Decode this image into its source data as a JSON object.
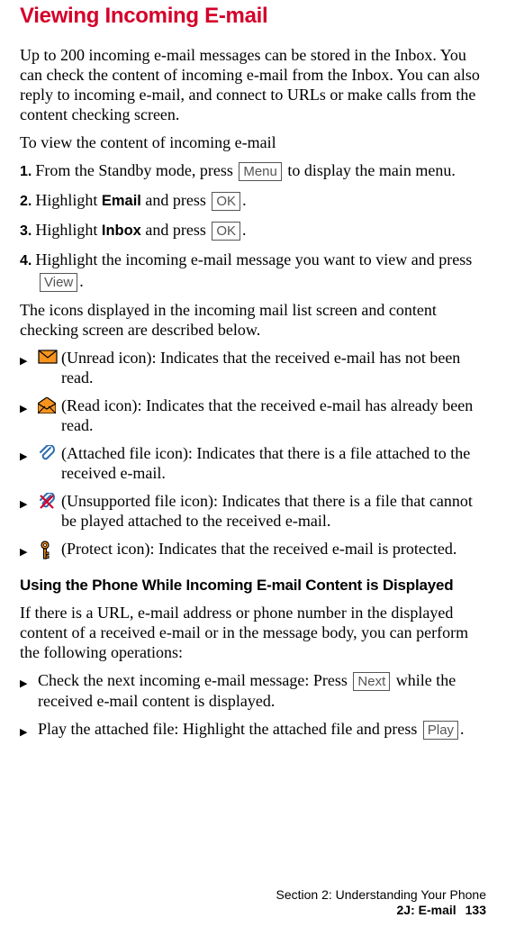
{
  "title": "Viewing Incoming E-mail",
  "intro": "Up to 200 incoming e-mail messages can be stored in the Inbox. You can check the content of incoming e-mail from the Inbox. You can also reply to incoming e-mail, and connect to URLs or make calls from the content checking screen.",
  "lead": "To view the content of incoming e-mail",
  "steps": {
    "s1": {
      "num": "1.",
      "a": "From the Standby mode, press ",
      "key": "Menu",
      "b": " to display the main menu."
    },
    "s2": {
      "num": "2.",
      "a": "Highlight ",
      "strong": "Email",
      "b": " and press ",
      "key": "OK",
      "c": "."
    },
    "s3": {
      "num": "3.",
      "a": "Highlight ",
      "strong": "Inbox",
      "b": " and press ",
      "key": "OK",
      "c": "."
    },
    "s4": {
      "num": "4.",
      "a": "Highlight the incoming e-mail message you want to view and press ",
      "key": "View",
      "b": "."
    }
  },
  "iconsLead": "The icons displayed in the incoming mail list screen and content checking screen are described below.",
  "icons": {
    "unread": " (Unread icon): Indicates that the received e-mail has not been read.",
    "read": " (Read icon): Indicates that the received e-mail has already been read.",
    "attached": " (Attached file icon): Indicates that there is a file attached to the received e-mail.",
    "unsupported": " (Unsupported file icon): Indicates that there is a file that cannot be played attached to the received e-mail.",
    "protect": " (Protect icon): Indicates that the received e-mail is protected."
  },
  "subHead": "Using the Phone While Incoming E-mail Content is Displayed",
  "subIntro": "If there is a URL, e-mail address or phone number in the displayed content of a received e-mail or in the message body, you can perform the following operations:",
  "ops": {
    "o1": {
      "a": "Check the next incoming e-mail message: Press ",
      "key": "Next",
      "b": " while the received e-mail content is displayed."
    },
    "o2": {
      "a": "Play the attached file: Highlight the attached file and press ",
      "key": "Play",
      "b": "."
    }
  },
  "footer": {
    "line1": "Section 2: Understanding Your Phone",
    "line2a": "2J: E-mail",
    "page": "133"
  }
}
